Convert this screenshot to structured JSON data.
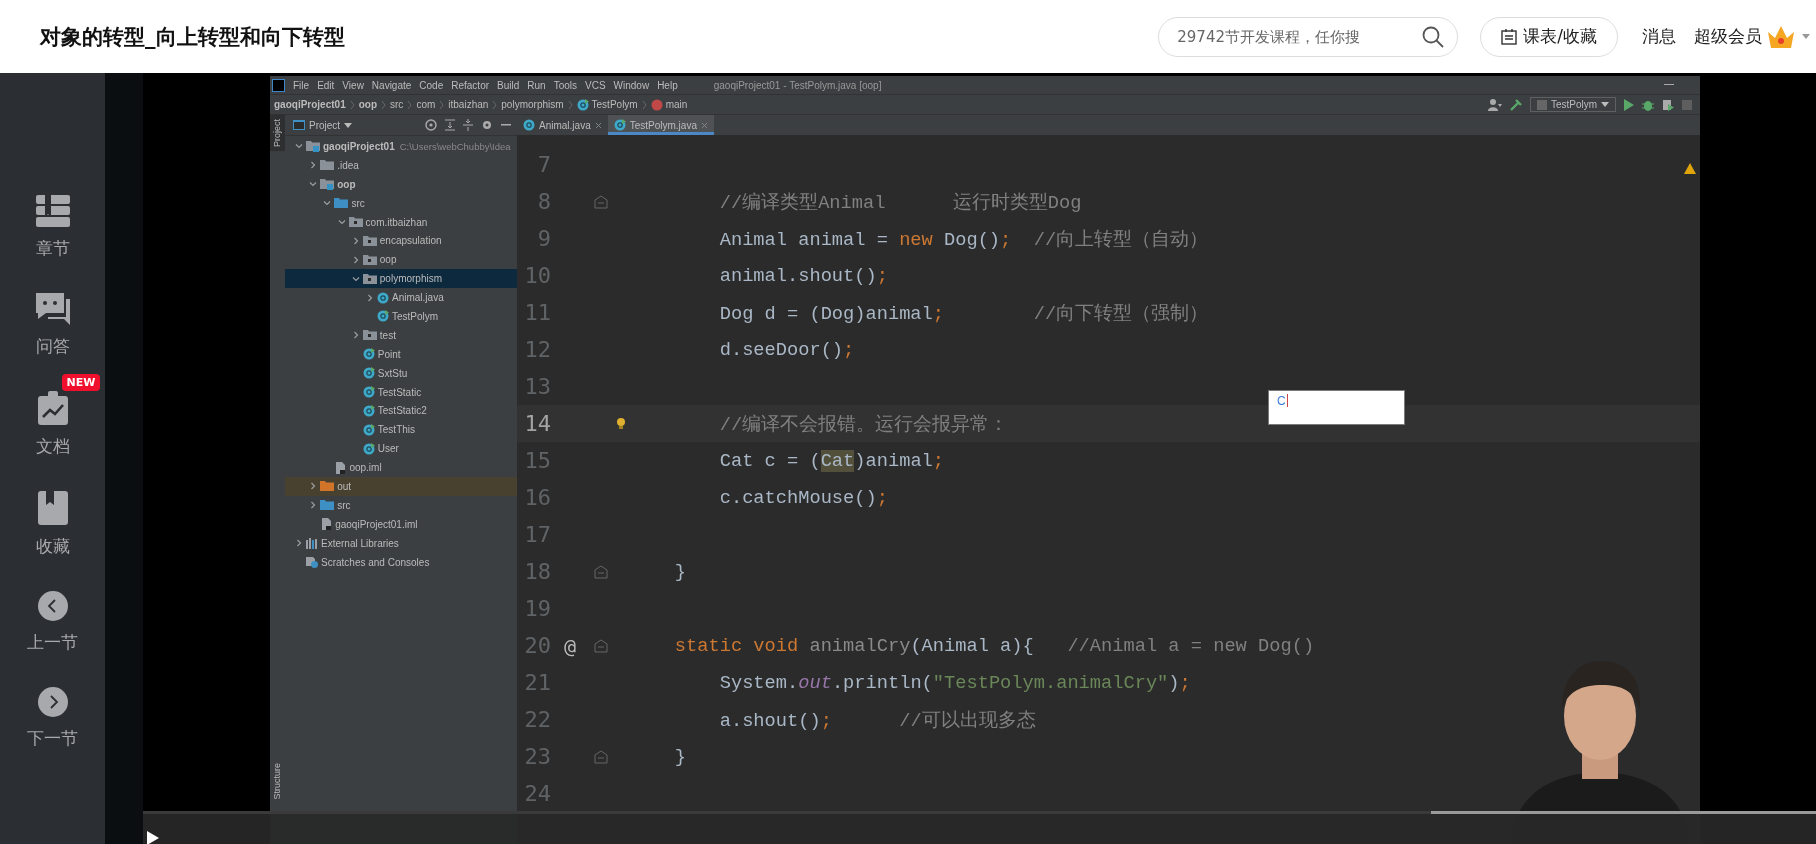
{
  "header": {
    "title": "对象的转型_向上转型和向下转型",
    "search": {
      "placeholder": "29742节开发课程，任你搜"
    },
    "schedule_button": "课表/收藏",
    "messages_link": "消息",
    "vip_link": "超级会员"
  },
  "sidebar": {
    "items": [
      {
        "kind": "chapters",
        "label": "章节"
      },
      {
        "kind": "qa",
        "label": "问答"
      },
      {
        "kind": "docs",
        "label": "文档",
        "badge": "NEW"
      },
      {
        "kind": "favorites",
        "label": "收藏"
      },
      {
        "kind": "prev",
        "label": "上一节"
      },
      {
        "kind": "next",
        "label": "下一节"
      }
    ]
  },
  "ide": {
    "menu": [
      "File",
      "Edit",
      "View",
      "Navigate",
      "Code",
      "Refactor",
      "Build",
      "Run",
      "Tools",
      "VCS",
      "Window",
      "Help"
    ],
    "window_title": "gaoqiProject01 - TestPolym.java [oop]",
    "breadcrumbs": [
      {
        "label": "gaoqiProject01",
        "bold": true,
        "kind": "text"
      },
      {
        "label": "oop",
        "bold": true,
        "kind": "text"
      },
      {
        "label": "src",
        "bold": false,
        "kind": "text"
      },
      {
        "label": "com",
        "bold": false,
        "kind": "text"
      },
      {
        "label": "itbaizhan",
        "bold": false,
        "kind": "text"
      },
      {
        "label": "polymorphism",
        "bold": false,
        "kind": "text"
      },
      {
        "label": "TestPolym",
        "bold": false,
        "kind": "class"
      },
      {
        "label": "main",
        "bold": false,
        "kind": "method"
      }
    ],
    "run_config": "TestPolym",
    "tool_windows": {
      "top": "Project",
      "bottom": "Structure"
    },
    "project_panel": {
      "title": "Project",
      "tree": [
        {
          "kind": "module",
          "label": "gaoqiProject01",
          "path": "C:\\Users\\webChubby\\Idea",
          "expanded": true,
          "selected": false,
          "children": [
            {
              "kind": "folder",
              "label": ".idea",
              "expanded": false,
              "selected": false
            },
            {
              "kind": "module",
              "label": "oop",
              "expanded": true,
              "selected": false,
              "children": [
                {
                  "kind": "source",
                  "label": "src",
                  "expanded": true,
                  "selected": false,
                  "children": [
                    {
                      "kind": "package",
                      "label": "com.itbaizhan",
                      "expanded": true,
                      "selected": false,
                      "children": [
                        {
                          "kind": "package",
                          "label": "encapsulation",
                          "expanded": false,
                          "selected": false
                        },
                        {
                          "kind": "package",
                          "label": "oop",
                          "expanded": false,
                          "selected": false
                        },
                        {
                          "kind": "package",
                          "label": "polymorphism",
                          "expanded": true,
                          "selected": true,
                          "children": [
                            {
                              "kind": "class",
                              "label": "Animal.java",
                              "expanded": false,
                              "selected": false
                            },
                            {
                              "kind": "main-class",
                              "label": "TestPolym",
                              "selected": false
                            }
                          ]
                        },
                        {
                          "kind": "package",
                          "label": "test",
                          "expanded": false,
                          "selected": false
                        },
                        {
                          "kind": "main-class",
                          "label": "Point",
                          "selected": false
                        },
                        {
                          "kind": "main-class",
                          "label": "SxtStu",
                          "selected": false
                        },
                        {
                          "kind": "main-class",
                          "label": "TestStatic",
                          "selected": false
                        },
                        {
                          "kind": "main-class",
                          "label": "TestStatic2",
                          "selected": false
                        },
                        {
                          "kind": "main-class",
                          "label": "TestThis",
                          "selected": false
                        },
                        {
                          "kind": "main-class",
                          "label": "User",
                          "selected": false
                        }
                      ]
                    }
                  ]
                },
                {
                  "kind": "iml",
                  "label": "oop.iml",
                  "selected": false
                }
              ]
            },
            {
              "kind": "excluded",
              "label": "out",
              "expanded": false,
              "selected": false
            },
            {
              "kind": "source",
              "label": "src",
              "expanded": false,
              "selected": false
            },
            {
              "kind": "iml",
              "label": "gaoqiProject01.iml",
              "selected": false
            }
          ]
        },
        {
          "kind": "libraries",
          "label": "External Libraries",
          "expanded": false,
          "selected": false
        },
        {
          "kind": "scratches",
          "label": "Scratches and Consoles",
          "selected": false
        }
      ]
    },
    "tabs": [
      {
        "label": "Animal.java",
        "selected": false
      },
      {
        "label": "TestPolym.java",
        "selected": true
      }
    ],
    "code_lines": [
      {
        "number": "7"
      },
      {
        "number": "8",
        "fold": true,
        "tokens": [
          {
            "kind": "comment",
            "text": "        //编译类型Animal      运行时类型Dog"
          }
        ]
      },
      {
        "number": "9",
        "tokens": [
          {
            "kind": "plain",
            "text": "        Animal animal = "
          },
          {
            "kind": "keyword",
            "text": "new "
          },
          {
            "kind": "plain",
            "text": "Dog()"
          },
          {
            "kind": "keyword",
            "text": ";"
          },
          {
            "kind": "comment",
            "text": "  //向上转型（自动）"
          }
        ]
      },
      {
        "number": "10",
        "tokens": [
          {
            "kind": "plain",
            "text": "        animal.shout()"
          },
          {
            "kind": "keyword",
            "text": ";"
          }
        ]
      },
      {
        "number": "11",
        "tokens": [
          {
            "kind": "plain",
            "text": "        Dog d = (Dog)animal"
          },
          {
            "kind": "keyword",
            "text": ";"
          },
          {
            "kind": "comment",
            "text": "        //向下转型（强制）"
          }
        ]
      },
      {
        "number": "12",
        "tokens": [
          {
            "kind": "plain",
            "text": "        d.seeDoor()"
          },
          {
            "kind": "keyword",
            "text": ";"
          }
        ]
      },
      {
        "number": "13"
      },
      {
        "number": "14",
        "current": true,
        "bulb": true,
        "tokens": [
          {
            "kind": "comment",
            "text": "        //编译不会报错。运行会报异常："
          }
        ]
      },
      {
        "number": "15",
        "tokens": [
          {
            "kind": "plain",
            "text": "        Cat c = ("
          },
          {
            "kind": "highlight",
            "text": "Cat"
          },
          {
            "kind": "plain",
            "text": ")animal"
          },
          {
            "kind": "keyword",
            "text": ";"
          }
        ]
      },
      {
        "number": "16",
        "tokens": [
          {
            "kind": "plain",
            "text": "        c.catchMouse()"
          },
          {
            "kind": "keyword",
            "text": ";"
          }
        ]
      },
      {
        "number": "17"
      },
      {
        "number": "18",
        "fold": true,
        "tokens": [
          {
            "kind": "plain",
            "text": "    }"
          }
        ]
      },
      {
        "number": "19"
      },
      {
        "number": "20",
        "fold": true,
        "gutter_mark": "@",
        "tokens": [
          {
            "kind": "keyword",
            "text": "    static void "
          },
          {
            "kind": "unused",
            "text": "animalCry"
          },
          {
            "kind": "plain",
            "text": "(Animal a){"
          },
          {
            "kind": "comment",
            "text": "   //Animal a = new Dog()"
          }
        ]
      },
      {
        "number": "21",
        "tokens": [
          {
            "kind": "plain",
            "text": "        System."
          },
          {
            "kind": "field",
            "text": "out"
          },
          {
            "kind": "plain",
            "text": ".println("
          },
          {
            "kind": "string",
            "text": "\"TestPolym.animalCry\""
          },
          {
            "kind": "plain",
            "text": ")"
          },
          {
            "kind": "keyword",
            "text": ";"
          }
        ]
      },
      {
        "number": "22",
        "tokens": [
          {
            "kind": "plain",
            "text": "        a.shout()"
          },
          {
            "kind": "keyword",
            "text": ";"
          },
          {
            "kind": "comment",
            "text": "      //可以出现多态"
          }
        ]
      },
      {
        "number": "23",
        "fold": true,
        "tokens": [
          {
            "kind": "plain",
            "text": "    }"
          }
        ]
      },
      {
        "number": "24"
      }
    ],
    "input_box": {
      "value": "C"
    }
  },
  "player": {
    "progress": {
      "level": 0.77
    }
  }
}
